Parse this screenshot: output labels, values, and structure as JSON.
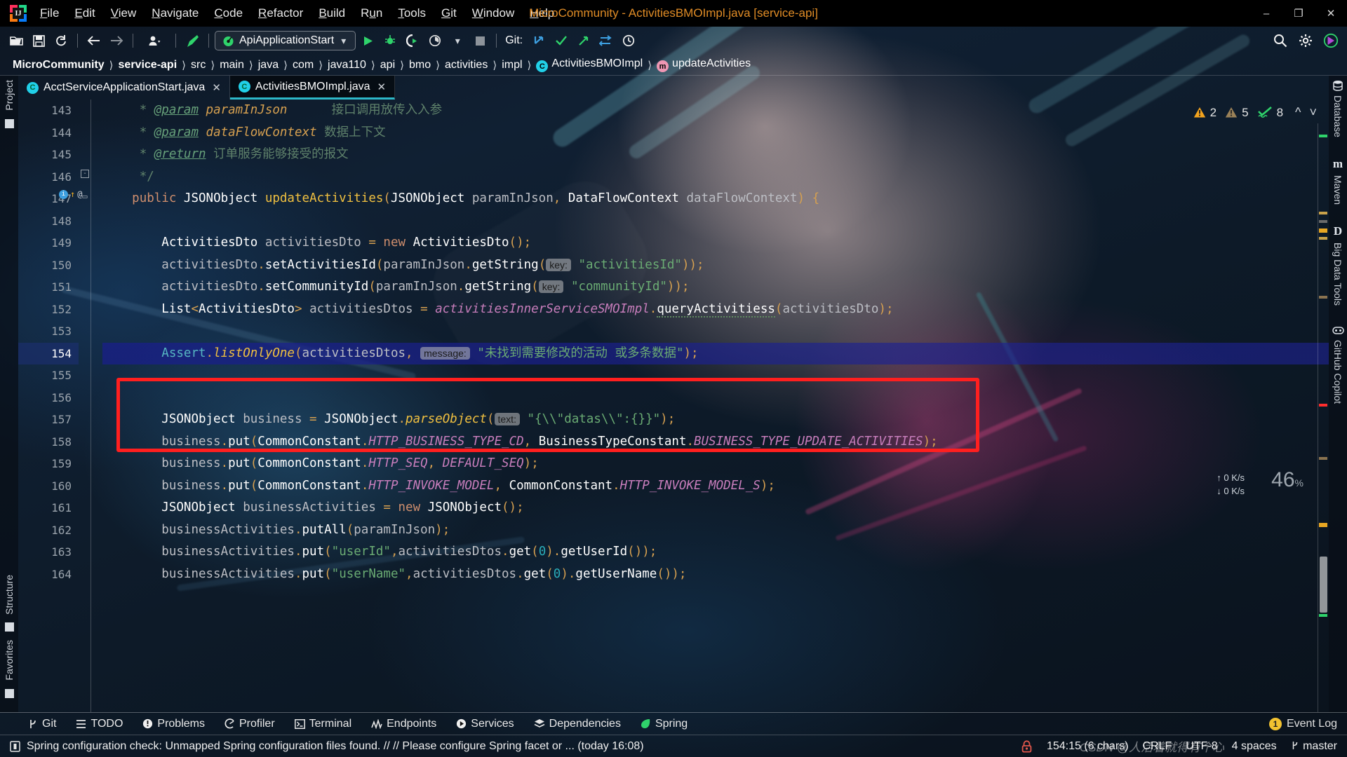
{
  "window": {
    "title": "MicroCommunity - ActivitiesBMOImpl.java [service-api]",
    "minimize": "–",
    "maximize": "❐",
    "close": "✕"
  },
  "menu": [
    {
      "label": "File"
    },
    {
      "label": "Edit"
    },
    {
      "label": "View"
    },
    {
      "label": "Navigate"
    },
    {
      "label": "Code"
    },
    {
      "label": "Refactor"
    },
    {
      "label": "Build"
    },
    {
      "label": "Run"
    },
    {
      "label": "Tools"
    },
    {
      "label": "Git"
    },
    {
      "label": "Window"
    },
    {
      "label": "Help"
    }
  ],
  "toolbar": {
    "open_icon": "open-folder-icon",
    "save_icon": "save-icon",
    "sync_icon": "sync-icon",
    "back_icon": "back-arrow-icon",
    "forward_icon": "forward-arrow-icon",
    "profile_icon": "user-profile-icon",
    "build_icon": "build-hammer-icon",
    "run_config": "ApiApplicationStart",
    "run_icon": "run-icon",
    "debug_icon": "debug-icon",
    "coverage_icon": "run-with-coverage-icon",
    "profiler_icon": "profiler-icon",
    "stop_icon": "stop-icon",
    "git_label": "Git:",
    "git_update_icon": "git-update-icon",
    "git_commit_icon": "git-commit-icon",
    "git_push_icon": "git-push-icon",
    "git_branch_icon": "git-branch-icon",
    "git_history_icon": "git-history-icon",
    "search_icon": "search-icon",
    "settings_icon": "gear-icon",
    "account_icon": "account-icon"
  },
  "breadcrumbs": [
    {
      "label": "MicroCommunity",
      "bold": true
    },
    {
      "label": "service-api",
      "bold": true
    },
    {
      "label": "src",
      "bold": false
    },
    {
      "label": "main",
      "bold": false
    },
    {
      "label": "java",
      "bold": false
    },
    {
      "label": "com",
      "bold": false
    },
    {
      "label": "java110",
      "bold": false
    },
    {
      "label": "api",
      "bold": false
    },
    {
      "label": "bmo",
      "bold": false
    },
    {
      "label": "activities",
      "bold": false
    },
    {
      "label": "impl",
      "bold": false
    },
    {
      "label": "ActivitiesBMOImpl",
      "bold": false,
      "icon": "C",
      "icon_color": "#21d0e8"
    },
    {
      "label": "updateActivities",
      "bold": false,
      "icon": "m",
      "icon_color": "#ef97b4"
    }
  ],
  "tabs": [
    {
      "label": "AcctServiceApplicationStart.java",
      "icon": "C",
      "icon_color": "#21d0e8",
      "active": false,
      "close": "✕"
    },
    {
      "label": "ActivitiesBMOImpl.java",
      "icon": "C",
      "icon_color": "#21d0e8",
      "active": true,
      "close": "✕"
    }
  ],
  "left_tool_windows": [
    {
      "label": "Project"
    },
    {
      "label": "Structure"
    },
    {
      "label": "Favorites"
    }
  ],
  "right_tool_windows": [
    {
      "label": "Database"
    },
    {
      "label": "Maven"
    },
    {
      "label": "Big Data Tools"
    },
    {
      "label": "GitHub Copilot"
    }
  ],
  "inspections": {
    "warnings": "2",
    "weak_warnings": "5",
    "typos": "8",
    "prev_icon": "chevron-up-icon",
    "next_icon": "chevron-down-icon"
  },
  "network": {
    "up": "0 K/s",
    "down": "0 K/s",
    "cpu": "46",
    "cpu_unit": "%"
  },
  "editor": {
    "first_line": 143,
    "current_line": 154,
    "lines": [
      {
        "n": 143,
        "html": "     <span class='cmt'>* </span><span class='tag'>@param</span><span class='cmt'> </span><span class='par'>paramInJson</span><span class='cmt'>      接口调用放传入入参</span>"
      },
      {
        "n": 144,
        "html": "     <span class='cmt'>* </span><span class='tag'>@param</span><span class='cmt'> </span><span class='par'>dataFlowContext</span><span class='cmt'> 数据上下文</span>"
      },
      {
        "n": 145,
        "html": "     <span class='cmt'>* </span><span class='tag'>@return</span><span class='cmt'> 订单服务能够接受的报文</span>"
      },
      {
        "n": 146,
        "html": "     <span class='cmt'>*/</span>"
      },
      {
        "n": 147,
        "html": "    <span class='kw'>public</span> <span class='typ'>JSONObject</span> <span class='mth'>updateActivities</span><span class='punc'>(</span><span class='typ'>JSONObject</span> <span class='id'>paramInJson</span><span class='punc'>,</span> <span class='typ'>DataFlowContext</span> <span class='id'>dataFlowContext</span><span class='punc'>)</span> <span class='punc'>{</span>"
      },
      {
        "n": 148,
        "html": ""
      },
      {
        "n": 149,
        "html": "        <span class='typ'>ActivitiesDto</span> <span class='id'>activitiesDto</span> <span class='punc'>=</span> <span class='kw'>new</span> <span class='typ'>ActivitiesDto</span><span class='punc'>();</span>"
      },
      {
        "n": 150,
        "html": "        <span class='id'>activitiesDto</span><span class='punc'>.</span><span class='typ'>setActivitiesId</span><span class='punc'>(</span><span class='id'>paramInJson</span><span class='punc'>.</span><span class='typ'>getString</span><span class='punc'>(</span><span class='hintchip'>key:</span> <span class='str'>\"activitiesId\"</span><span class='punc'>));</span>"
      },
      {
        "n": 151,
        "html": "        <span class='id'>activitiesDto</span><span class='punc'>.</span><span class='typ'>setCommunityId</span><span class='punc'>(</span><span class='id'>paramInJson</span><span class='punc'>.</span><span class='typ'>getString</span><span class='punc'>(</span><span class='hintchip'>key:</span> <span class='str'>\"communityId\"</span><span class='punc'>));</span>"
      },
      {
        "n": 152,
        "html": "        <span class='typ'>List</span><span class='punc'>&lt;</span><span class='typ'>ActivitiesDto</span><span class='punc'>&gt;</span> <span class='id'>activitiesDtos</span> <span class='punc'>=</span> <span class='fld'>activitiesInnerServiceSMOImpl</span><span class='punc'>.</span><span class='typ squig'>queryActivitiess</span><span class='punc'>(</span><span class='id'>activitiesDto</span><span class='punc'>);</span>"
      },
      {
        "n": 153,
        "html": ""
      },
      {
        "n": 154,
        "html": "        <span class='asrt'>Assert</span><span class='punc'>.</span><span class='mthi'>listOnlyOne</span><span class='punc'>(</span><span class='id'>activitiesDtos</span><span class='punc'>,</span> <span class='hintchip'>message:</span> <span class='str'>\"未找到需要修改的活动 或多条数据\"</span><span class='punc'>);</span>",
        "highlight": true
      },
      {
        "n": 155,
        "html": ""
      },
      {
        "n": 156,
        "html": ""
      },
      {
        "n": 157,
        "html": "        <span class='typ'>JSONObject</span> <span class='id'>business</span> <span class='punc'>=</span> <span class='typ'>JSONObject</span><span class='punc'>.</span><span class='mthi'>parseObject</span><span class='punc'>(</span><span class='hintchip'>text:</span> <span class='str'>\"{\\\\\"datas\\\\\":{}}\"</span><span class='punc'>);</span>"
      },
      {
        "n": 158,
        "html": "        <span class='id'>business</span><span class='punc'>.</span><span class='typ'>put</span><span class='punc'>(</span><span class='typ'>CommonConstant</span><span class='punc'>.</span><span class='stat'>HTTP_BUSINESS_TYPE_CD</span><span class='punc'>,</span> <span class='typ'>BusinessTypeConstant</span><span class='punc'>.</span><span class='stat'>BUSINESS_TYPE_UPDATE_ACTIVITIES</span><span class='punc'>);</span>"
      },
      {
        "n": 159,
        "html": "        <span class='id'>business</span><span class='punc'>.</span><span class='typ'>put</span><span class='punc'>(</span><span class='typ'>CommonConstant</span><span class='punc'>.</span><span class='stat'>HTTP_SEQ</span><span class='punc'>,</span> <span class='stat'>DEFAULT_SEQ</span><span class='punc'>);</span>"
      },
      {
        "n": 160,
        "html": "        <span class='id'>business</span><span class='punc'>.</span><span class='typ'>put</span><span class='punc'>(</span><span class='typ'>CommonConstant</span><span class='punc'>.</span><span class='stat'>HTTP_INVOKE_MODEL</span><span class='punc'>,</span> <span class='typ'>CommonConstant</span><span class='punc'>.</span><span class='stat'>HTTP_INVOKE_MODEL_S</span><span class='punc'>);</span>"
      },
      {
        "n": 161,
        "html": "        <span class='typ'>JSONObject</span> <span class='id'>businessActivities</span> <span class='punc'>=</span> <span class='kw'>new</span> <span class='typ'>JSONObject</span><span class='punc'>();</span>"
      },
      {
        "n": 162,
        "html": "        <span class='id'>businessActivities</span><span class='punc'>.</span><span class='typ'>putAll</span><span class='punc'>(</span><span class='id'>paramInJson</span><span class='punc'>);</span>"
      },
      {
        "n": 163,
        "html": "        <span class='id'>businessActivities</span><span class='punc'>.</span><span class='typ'>put</span><span class='punc'>(</span><span class='str'>\"userId\"</span><span class='punc'>,</span><span class='id'>activitiesDtos</span><span class='punc'>.</span><span class='typ'>get</span><span class='punc'>(</span><span class='num'>0</span><span class='punc'>).</span><span class='typ'>getUserId</span><span class='punc'>());</span>"
      },
      {
        "n": 164,
        "html": "        <span class='id'>businessActivities</span><span class='punc'>.</span><span class='typ'>put</span><span class='punc'>(</span><span class='str'>\"userName\"</span><span class='punc'>,</span><span class='id'>activitiesDtos</span><span class='punc'>.</span><span class='typ'>get</span><span class='punc'>(</span><span class='num'>0</span><span class='punc'>).</span><span class='typ'>getUserName</span><span class='punc'>());</span>"
      }
    ]
  },
  "bottom_tools": [
    {
      "label": "Git",
      "icon": "git-branch-icon"
    },
    {
      "label": "TODO",
      "icon": "todo-list-icon"
    },
    {
      "label": "Problems",
      "icon": "problems-icon"
    },
    {
      "label": "Profiler",
      "icon": "profiler-icon"
    },
    {
      "label": "Terminal",
      "icon": "terminal-icon"
    },
    {
      "label": "Endpoints",
      "icon": "endpoints-icon"
    },
    {
      "label": "Services",
      "icon": "services-icon"
    },
    {
      "label": "Dependencies",
      "icon": "dependencies-icon"
    },
    {
      "label": "Spring",
      "icon": "spring-leaf-icon"
    }
  ],
  "event_log": {
    "count": "1",
    "label": "Event Log"
  },
  "status": {
    "message": "Spring configuration check: Unmapped Spring configuration files found. // // Please configure Spring facet or ... (today 16:08)",
    "message_icon": "notification-icon",
    "lock_icon": "read-only-lock-icon",
    "caret": "154:15 (6 chars)",
    "line_sep": "CRLF",
    "encoding": "UTF-8",
    "indent": "4 spaces",
    "branch": "master",
    "branch_icon": "git-branch-icon"
  },
  "watermark": "CSDN @人活着就得有个心",
  "colors": {
    "title_accent": "#e08c26",
    "tab_active_underline": "#2db8c8",
    "annotation_red": "#ff1f1f",
    "highlight_blue": "#1e2390"
  }
}
